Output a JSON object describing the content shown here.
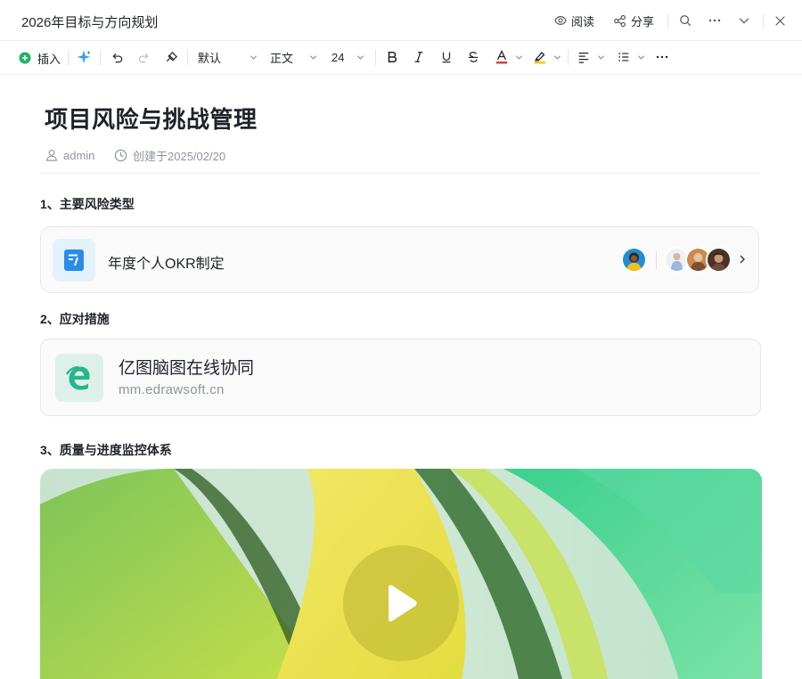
{
  "window": {
    "title": "2026年目标与方向规划",
    "read_label": "阅读",
    "share_label": "分享"
  },
  "toolbar": {
    "insert_label": "插入",
    "font_family": "默认",
    "text_style": "正文",
    "font_size": "24",
    "font_color": "#e53935",
    "highlight_color": "#f5c518"
  },
  "document": {
    "title": "项目风险与挑战管理",
    "author": "admin",
    "created": "创建于2025/02/20",
    "sections": [
      {
        "heading": "1、主要风险类型"
      },
      {
        "heading": "2、应对措施"
      },
      {
        "heading": "3、质量与进度监控体系"
      }
    ],
    "linked_doc": {
      "title": "年度个人OKR制定",
      "icon": "document-icon",
      "accent": "#2a8be8"
    },
    "link_card": {
      "title": "亿图脑图在线协同",
      "url": "mm.edrawsoft.cn",
      "icon": "edge-browser-icon",
      "accent": "#27b58c"
    },
    "video": {
      "icon": "play-icon"
    }
  }
}
